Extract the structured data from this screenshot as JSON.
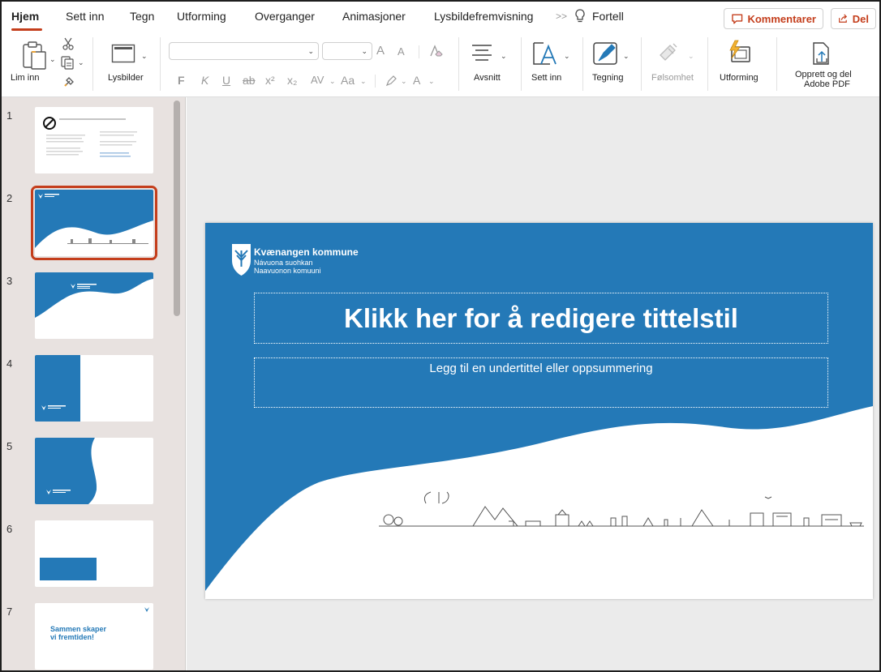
{
  "tabs": [
    {
      "label": "Hjem",
      "active": true
    },
    {
      "label": "Sett inn"
    },
    {
      "label": "Tegn"
    },
    {
      "label": "Utforming"
    },
    {
      "label": "Overganger"
    },
    {
      "label": "Animasjoner"
    },
    {
      "label": "Lysbildefremvisning"
    }
  ],
  "tell_me": "Fortell",
  "comments_label": "Kommentarer",
  "share_label": "Del",
  "ribbon": {
    "paste": "Lim inn",
    "slides": "Lysbilder",
    "paragraph": "Avsnitt",
    "insert": "Sett inn",
    "drawing": "Tegning",
    "sensitivity": "Følsomhet",
    "designer": "Utforming",
    "pdf_line1": "Opprett og del",
    "pdf_line2": "Adobe PDF",
    "bold": "F",
    "italic": "K",
    "underline": "U",
    "strike": "ab",
    "superscript": "x²",
    "subscript": "x₂",
    "spacing": "AV",
    "case": "Aa",
    "font_grow": "A",
    "font_shrink": "A",
    "font_color": "A"
  },
  "thumbnails": [
    {
      "num": "1",
      "kind": "text"
    },
    {
      "num": "2",
      "kind": "wave",
      "selected": true
    },
    {
      "num": "3",
      "kind": "wave"
    },
    {
      "num": "4",
      "kind": "sidebar"
    },
    {
      "num": "5",
      "kind": "curve"
    },
    {
      "num": "6",
      "kind": "box"
    },
    {
      "num": "7",
      "kind": "text2",
      "text_line1": "Sammen skaper",
      "text_line2": "vi fremtiden!"
    }
  ],
  "slide": {
    "org_name": "Kvænangen kommune",
    "org_line2": "Návuona suohkan",
    "org_line3": "Naavuonon komuuni",
    "title_placeholder": "Klikk her for å redigere tittelstil",
    "subtitle_placeholder": "Legg til en undertittel eller oppsummering"
  },
  "colors": {
    "accent": "#c43e1c",
    "brand_blue": "#2479b7"
  }
}
